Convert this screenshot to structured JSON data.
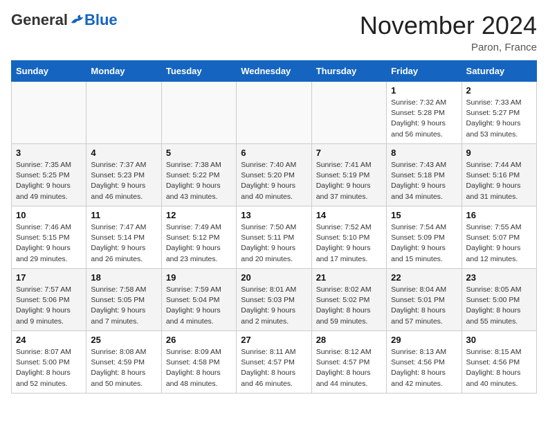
{
  "header": {
    "logo_general": "General",
    "logo_blue": "Blue",
    "month_title": "November 2024",
    "location": "Paron, France"
  },
  "weekdays": [
    "Sunday",
    "Monday",
    "Tuesday",
    "Wednesday",
    "Thursday",
    "Friday",
    "Saturday"
  ],
  "weeks": [
    {
      "alt": false,
      "days": [
        {
          "num": "",
          "info": ""
        },
        {
          "num": "",
          "info": ""
        },
        {
          "num": "",
          "info": ""
        },
        {
          "num": "",
          "info": ""
        },
        {
          "num": "",
          "info": ""
        },
        {
          "num": "1",
          "info": "Sunrise: 7:32 AM\nSunset: 5:28 PM\nDaylight: 9 hours\nand 56 minutes."
        },
        {
          "num": "2",
          "info": "Sunrise: 7:33 AM\nSunset: 5:27 PM\nDaylight: 9 hours\nand 53 minutes."
        }
      ]
    },
    {
      "alt": true,
      "days": [
        {
          "num": "3",
          "info": "Sunrise: 7:35 AM\nSunset: 5:25 PM\nDaylight: 9 hours\nand 49 minutes."
        },
        {
          "num": "4",
          "info": "Sunrise: 7:37 AM\nSunset: 5:23 PM\nDaylight: 9 hours\nand 46 minutes."
        },
        {
          "num": "5",
          "info": "Sunrise: 7:38 AM\nSunset: 5:22 PM\nDaylight: 9 hours\nand 43 minutes."
        },
        {
          "num": "6",
          "info": "Sunrise: 7:40 AM\nSunset: 5:20 PM\nDaylight: 9 hours\nand 40 minutes."
        },
        {
          "num": "7",
          "info": "Sunrise: 7:41 AM\nSunset: 5:19 PM\nDaylight: 9 hours\nand 37 minutes."
        },
        {
          "num": "8",
          "info": "Sunrise: 7:43 AM\nSunset: 5:18 PM\nDaylight: 9 hours\nand 34 minutes."
        },
        {
          "num": "9",
          "info": "Sunrise: 7:44 AM\nSunset: 5:16 PM\nDaylight: 9 hours\nand 31 minutes."
        }
      ]
    },
    {
      "alt": false,
      "days": [
        {
          "num": "10",
          "info": "Sunrise: 7:46 AM\nSunset: 5:15 PM\nDaylight: 9 hours\nand 29 minutes."
        },
        {
          "num": "11",
          "info": "Sunrise: 7:47 AM\nSunset: 5:14 PM\nDaylight: 9 hours\nand 26 minutes."
        },
        {
          "num": "12",
          "info": "Sunrise: 7:49 AM\nSunset: 5:12 PM\nDaylight: 9 hours\nand 23 minutes."
        },
        {
          "num": "13",
          "info": "Sunrise: 7:50 AM\nSunset: 5:11 PM\nDaylight: 9 hours\nand 20 minutes."
        },
        {
          "num": "14",
          "info": "Sunrise: 7:52 AM\nSunset: 5:10 PM\nDaylight: 9 hours\nand 17 minutes."
        },
        {
          "num": "15",
          "info": "Sunrise: 7:54 AM\nSunset: 5:09 PM\nDaylight: 9 hours\nand 15 minutes."
        },
        {
          "num": "16",
          "info": "Sunrise: 7:55 AM\nSunset: 5:07 PM\nDaylight: 9 hours\nand 12 minutes."
        }
      ]
    },
    {
      "alt": true,
      "days": [
        {
          "num": "17",
          "info": "Sunrise: 7:57 AM\nSunset: 5:06 PM\nDaylight: 9 hours\nand 9 minutes."
        },
        {
          "num": "18",
          "info": "Sunrise: 7:58 AM\nSunset: 5:05 PM\nDaylight: 9 hours\nand 7 minutes."
        },
        {
          "num": "19",
          "info": "Sunrise: 7:59 AM\nSunset: 5:04 PM\nDaylight: 9 hours\nand 4 minutes."
        },
        {
          "num": "20",
          "info": "Sunrise: 8:01 AM\nSunset: 5:03 PM\nDaylight: 9 hours\nand 2 minutes."
        },
        {
          "num": "21",
          "info": "Sunrise: 8:02 AM\nSunset: 5:02 PM\nDaylight: 8 hours\nand 59 minutes."
        },
        {
          "num": "22",
          "info": "Sunrise: 8:04 AM\nSunset: 5:01 PM\nDaylight: 8 hours\nand 57 minutes."
        },
        {
          "num": "23",
          "info": "Sunrise: 8:05 AM\nSunset: 5:00 PM\nDaylight: 8 hours\nand 55 minutes."
        }
      ]
    },
    {
      "alt": false,
      "days": [
        {
          "num": "24",
          "info": "Sunrise: 8:07 AM\nSunset: 5:00 PM\nDaylight: 8 hours\nand 52 minutes."
        },
        {
          "num": "25",
          "info": "Sunrise: 8:08 AM\nSunset: 4:59 PM\nDaylight: 8 hours\nand 50 minutes."
        },
        {
          "num": "26",
          "info": "Sunrise: 8:09 AM\nSunset: 4:58 PM\nDaylight: 8 hours\nand 48 minutes."
        },
        {
          "num": "27",
          "info": "Sunrise: 8:11 AM\nSunset: 4:57 PM\nDaylight: 8 hours\nand 46 minutes."
        },
        {
          "num": "28",
          "info": "Sunrise: 8:12 AM\nSunset: 4:57 PM\nDaylight: 8 hours\nand 44 minutes."
        },
        {
          "num": "29",
          "info": "Sunrise: 8:13 AM\nSunset: 4:56 PM\nDaylight: 8 hours\nand 42 minutes."
        },
        {
          "num": "30",
          "info": "Sunrise: 8:15 AM\nSunset: 4:56 PM\nDaylight: 8 hours\nand 40 minutes."
        }
      ]
    }
  ]
}
